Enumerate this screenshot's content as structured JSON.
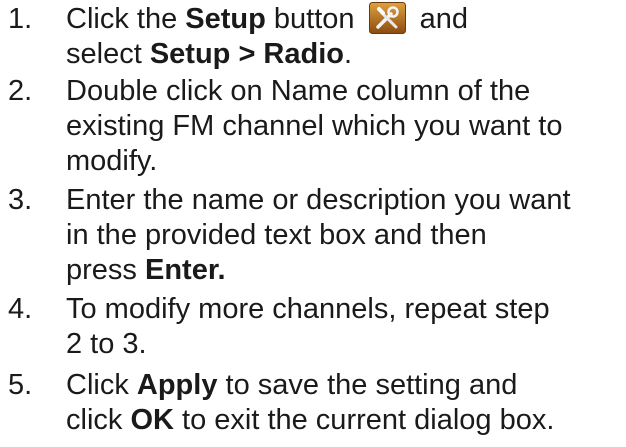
{
  "steps": [
    {
      "number": "1.",
      "line1": {
        "pre": "Click the ",
        "bold": "Setup",
        "post": " button ",
        "after_icon": " and"
      },
      "line2": {
        "pre": "select ",
        "bold": "Setup > Radio",
        "post": "."
      },
      "icon": "setup-tools-icon"
    },
    {
      "number": "2.",
      "lines": [
        "Double click on Name column of the",
        "existing FM channel which you want to",
        "modify."
      ]
    },
    {
      "number": "3.",
      "lines": [
        "Enter the name or description you want",
        "in the provided text box and then"
      ],
      "line3": {
        "pre": "press ",
        "bold": "Enter."
      }
    },
    {
      "number": "4.",
      "lines": [
        "To modify more channels, repeat step",
        "2 to 3."
      ]
    },
    {
      "number": "5.",
      "line1": {
        "pre": "Click ",
        "bold": "Apply",
        "post": " to save the setting and"
      },
      "line2": {
        "pre": "click ",
        "bold": "OK",
        "post": " to exit the current dialog box."
      }
    }
  ],
  "colors": {
    "text": "#1a1a1a",
    "icon_bg": "#c07a1e"
  }
}
